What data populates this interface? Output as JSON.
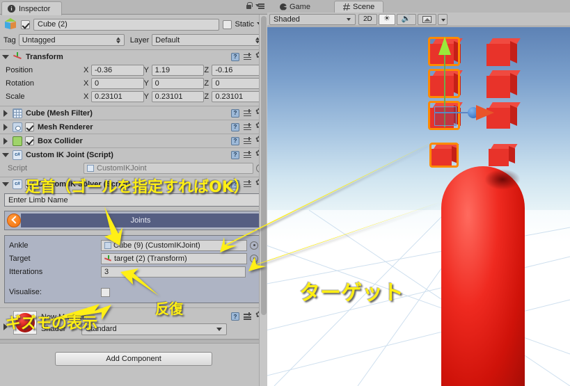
{
  "inspector": {
    "tab_label": "Inspector",
    "icons": {
      "info": "info-icon",
      "lock": "lock-icon",
      "menu": "hamburger-menu-icon"
    },
    "game_object": {
      "name_value": "Cube (2)",
      "enabled": true,
      "static_label": "Static",
      "tag_label": "Tag",
      "tag_value": "Untagged",
      "layer_label": "Layer",
      "layer_value": "Default"
    },
    "transform": {
      "title": "Transform",
      "rows": [
        {
          "label": "Position",
          "x": "-0.36",
          "y": "1.19",
          "z": "-0.16"
        },
        {
          "label": "Rotation",
          "x": "0",
          "y": "0",
          "z": "0"
        },
        {
          "label": "Scale",
          "x": "0.23101",
          "y": "0.23101",
          "z": "0.23101"
        }
      ],
      "axis_x": "X",
      "axis_y": "Y",
      "axis_z": "Z"
    },
    "components": [
      {
        "title": "Cube (Mesh Filter)",
        "has_checkbox": false,
        "icon": "mesh-filter-icon"
      },
      {
        "title": "Mesh Renderer",
        "has_checkbox": true,
        "icon": "mesh-renderer-icon"
      },
      {
        "title": "Box Collider",
        "has_checkbox": true,
        "icon": "box-collider-icon"
      }
    ],
    "ik_joint": {
      "title": "Custom IK Joint (Script)",
      "script_label": "Script",
      "script_value": "CustomIKJoint"
    },
    "ik_solver": {
      "title": "Custom IK Solver (Script)",
      "enabled": true,
      "limb_name_placeholder": "Enter Limb Name",
      "limb_name_value": "",
      "joints_label": "Joints",
      "fields": [
        {
          "label": "Ankle",
          "value": "Cube (9) (CustomIKJoint)",
          "icon": "cube-asset-icon"
        },
        {
          "label": "Target",
          "value": "target (2) (Transform)",
          "icon": "transform-icon"
        },
        {
          "label": "Itterations",
          "value": "3",
          "icon": ""
        }
      ],
      "visualise_label": "Visualise:",
      "visualise_checked": false
    },
    "material": {
      "name": "New Material",
      "shader_label": "Shader",
      "shader_value": "Standard"
    },
    "add_component_label": "Add Component"
  },
  "scene_panel": {
    "tabs": [
      {
        "label": "Game",
        "icon": "game-view-icon",
        "active": false
      },
      {
        "label": "Scene",
        "icon": "scene-view-icon",
        "active": true
      }
    ],
    "toolbar": {
      "draw_mode": "Shaded",
      "two_d_label": "2D",
      "lighting_icon": "sun-icon",
      "audio_icon": "speaker-icon",
      "effects_icon": "image-icon",
      "effects_caret_icon": "chevron-down-icon"
    }
  },
  "annotations": [
    {
      "id": "ankle",
      "text": "足首（ゴールを指定すればOK）"
    },
    {
      "id": "gizmo",
      "text": "ギズモの表示"
    },
    {
      "id": "iter",
      "text": "反復"
    },
    {
      "id": "target",
      "text": "ターゲット"
    }
  ],
  "colors": {
    "annotation_yellow": "#ffef14",
    "inspector_bg": "#c2c2c2",
    "solver_panel_bg": "#aeb4c4",
    "joints_bar_blue": "#555e82",
    "joints_handle_orange": "#f2700d",
    "selection_orange": "#ff8a00",
    "cube_red": "#e8332a",
    "gizmo_y_green": "#9bea3a",
    "gizmo_x_red": "#e8552a",
    "gizmo_ball_blue": "#2a63b8",
    "sky_top": "#5d82b5",
    "sky_bottom": "#e7f3f7"
  }
}
